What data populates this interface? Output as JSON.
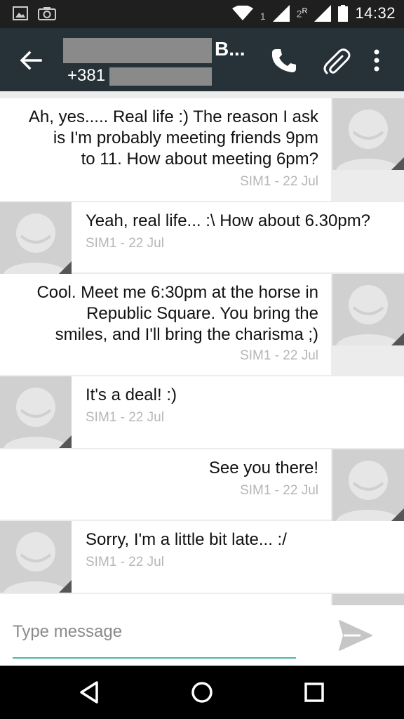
{
  "status_bar": {
    "sim1_indicator": "1",
    "sim2_indicator": "2",
    "roaming": "R",
    "time": "14:32",
    "icons": [
      "image-icon",
      "camera-icon",
      "wifi-icon",
      "signal-icon",
      "signal-roaming-icon",
      "battery-icon"
    ]
  },
  "toolbar": {
    "contact_name_suffix": "B...",
    "phone_prefix": "+381",
    "icons": [
      "back-arrow-icon",
      "phone-icon",
      "paperclip-icon",
      "more-vert-icon"
    ]
  },
  "messages": [
    {
      "direction": "out",
      "lines": [
        "Ah, yes..... Real life :) The reason I ask",
        "is I'm probably meeting friends 9pm",
        "to 11. How about meeting 6pm?"
      ],
      "meta": "SIM1 - 22 Jul"
    },
    {
      "direction": "in",
      "lines": [
        "Yeah, real life... :\\ How about 6.30pm?"
      ],
      "meta": "SIM1 - 22 Jul"
    },
    {
      "direction": "out",
      "lines": [
        "Cool. Meet me 6:30pm at the horse in",
        "Republic Square. You bring the",
        "smiles, and I'll bring the charisma ;)"
      ],
      "meta": "SIM1 - 22 Jul"
    },
    {
      "direction": "in",
      "lines": [
        "It's a deal! :)"
      ],
      "meta": "SIM1 - 22 Jul"
    },
    {
      "direction": "out",
      "lines": [
        "See you there!"
      ],
      "meta": "SIM1 - 22 Jul"
    },
    {
      "direction": "in",
      "lines": [
        "Sorry, I'm a little bit late... :/"
      ],
      "meta": "SIM1 - 22 Jul"
    }
  ],
  "composer": {
    "placeholder": "Type message",
    "value": ""
  },
  "colors": {
    "status_bar": "#1f1f1f",
    "toolbar": "#263238",
    "accent": "#4db6ac",
    "background": "#ececec"
  }
}
